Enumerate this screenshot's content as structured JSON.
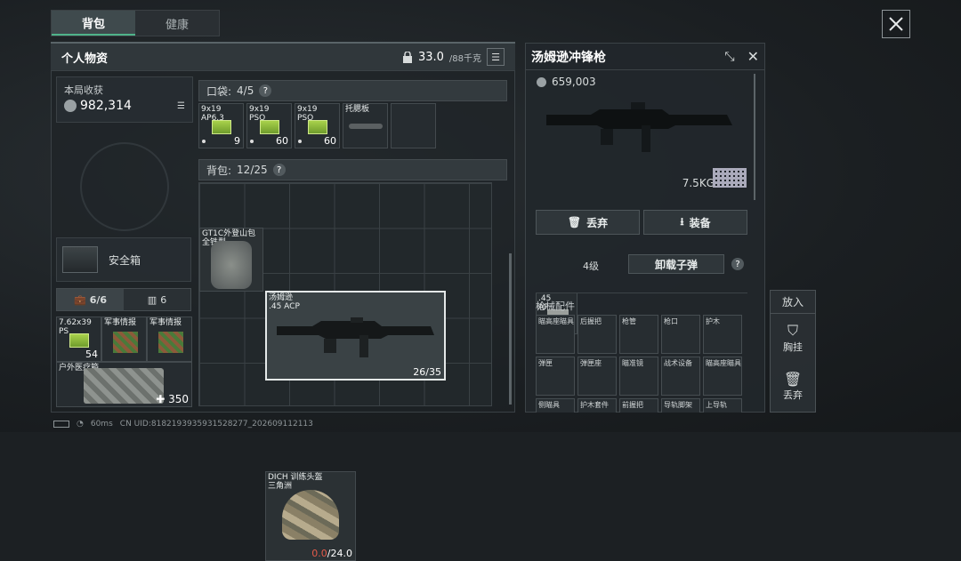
{
  "tabs": [
    "背包",
    "健康"
  ],
  "header": {
    "title": "个人物资",
    "weight": "33.0",
    "weight_max": "/88千克"
  },
  "harvest": {
    "label": "本局收获",
    "value": "982,314"
  },
  "pocket": {
    "label": "口袋:",
    "count": "4/5"
  },
  "pocket_items": [
    {
      "label": "9x19\nAP6.3",
      "count": "9"
    },
    {
      "label": "9x19\nPSO",
      "count": "60"
    },
    {
      "label": "9x19\nPSO",
      "count": "60"
    },
    {
      "label": "托腮板",
      "count": ""
    }
  ],
  "backpack": {
    "label": "背包:",
    "count": "12/25"
  },
  "backpack_items": {
    "bag": "GT1C外登山包\n全铁型",
    "gun": {
      "label": "汤姆逊\n.45 ACP",
      "count": "26/35"
    },
    "helmet": {
      "label": "DICH 训练头盔\n三角洲",
      "dur_cur": "0.0",
      "dur_max": "/24.0"
    }
  },
  "safebox": {
    "label": "安全箱"
  },
  "left_tabs": {
    "a": "6/6",
    "b": "6"
  },
  "left_items": [
    {
      "label": "7.62x39\nPS",
      "count": "54"
    },
    {
      "label": "军事情报",
      "count": ""
    },
    {
      "label": "军事情报",
      "count": ""
    }
  ],
  "medkit": {
    "label": "户外医疗箱",
    "count": "350"
  },
  "detail": {
    "title": "汤姆逊冲锋枪",
    "price": "659,003",
    "weight": "7.5KG",
    "discard": "丢弃",
    "equip": "装备",
    "ammo_label": ".45\nAP",
    "level": "4级",
    "unload": "卸载子弹",
    "attachments_title": "枪械配件",
    "attachments": [
      "瞄高座瞄具",
      "后握把",
      "枪管",
      "枪口",
      "护木",
      "弹匣",
      "弹匣座",
      "瞄准镜",
      "战术设备",
      "瞄高座瞄具",
      "侧瞄具",
      "护木套件",
      "前握把",
      "导轨脚架",
      "上导轨"
    ]
  },
  "side_panel": {
    "title": "放入",
    "b1": "胸挂",
    "b2": "丢弃"
  },
  "status": {
    "ping": "60ms",
    "uid": "CN UID:8182193935931528277_202609112113"
  }
}
